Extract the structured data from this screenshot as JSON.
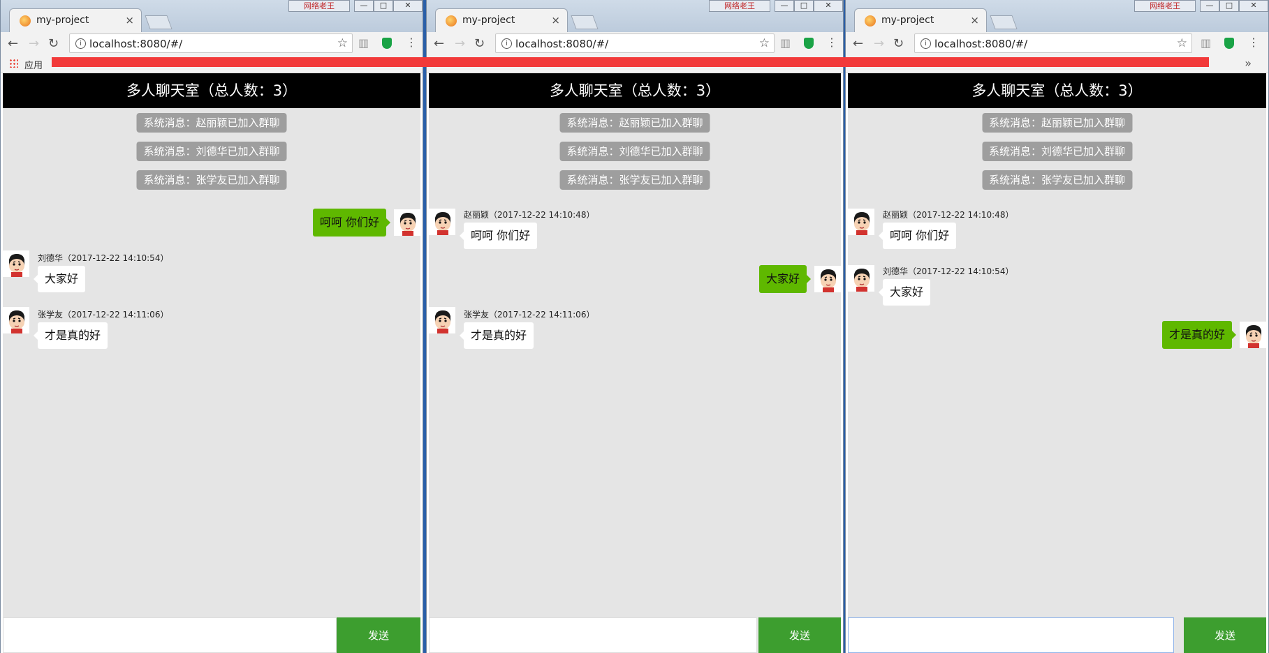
{
  "browser": {
    "tab_title": "my-project",
    "tab_close": "×",
    "url": "localhost:8080/#/",
    "apps_label": "应用",
    "ext_label": "网络老王",
    "overflow": "»"
  },
  "chat": {
    "header": "多人聊天室（总人数：3）",
    "send_label": "发送",
    "system_messages": [
      "系统消息：赵丽颖已加入群聊",
      "系统消息：刘德华已加入群聊",
      "系统消息：张学友已加入群聊"
    ]
  },
  "windows": [
    {
      "messages": [
        {
          "self": true,
          "text": "呵呵 你们好"
        },
        {
          "self": false,
          "meta": "刘德华（2017-12-22 14:10:54）",
          "text": "大家好"
        },
        {
          "self": false,
          "meta": "张学友（2017-12-22 14:11:06）",
          "text": "才是真的好"
        }
      ]
    },
    {
      "messages": [
        {
          "self": false,
          "meta": "赵丽颖（2017-12-22 14:10:48）",
          "text": "呵呵 你们好"
        },
        {
          "self": true,
          "text": "大家好"
        },
        {
          "self": false,
          "meta": "张学友（2017-12-22 14:11:06）",
          "text": "才是真的好"
        }
      ]
    },
    {
      "messages": [
        {
          "self": false,
          "meta": "赵丽颖（2017-12-22 14:10:48）",
          "text": "呵呵 你们好"
        },
        {
          "self": false,
          "meta": "刘德华（2017-12-22 14:10:54）",
          "text": "大家好"
        },
        {
          "self": true,
          "text": "才是真的好"
        }
      ]
    }
  ]
}
